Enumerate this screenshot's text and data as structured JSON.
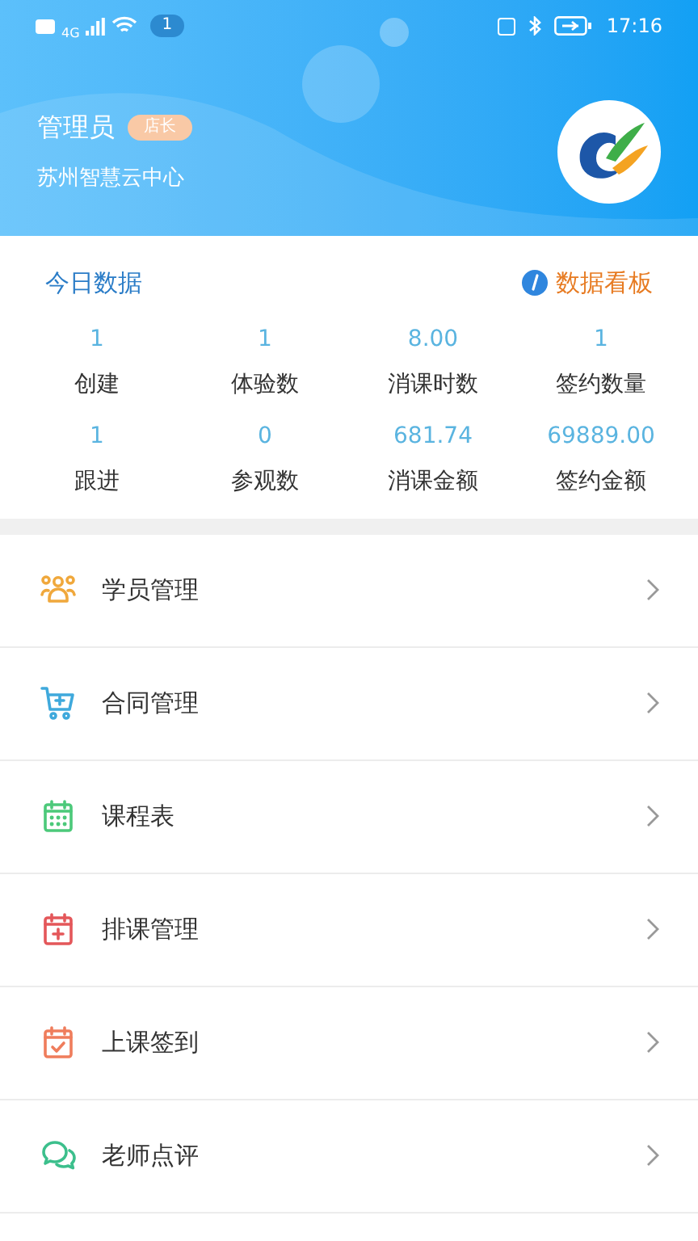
{
  "status_bar": {
    "network": "4G",
    "notification_count": "1",
    "time": "17:16"
  },
  "profile": {
    "name": "管理员",
    "role_badge": "店长",
    "organization": "苏州智慧云中心"
  },
  "today_data": {
    "title": "今日数据",
    "dashboard_link": "数据看板",
    "stats": [
      {
        "value": "1",
        "label": "创建"
      },
      {
        "value": "1",
        "label": "体验数"
      },
      {
        "value": "8.00",
        "label": "消课时数"
      },
      {
        "value": "1",
        "label": "签约数量"
      },
      {
        "value": "1",
        "label": "跟进"
      },
      {
        "value": "0",
        "label": "参观数"
      },
      {
        "value": "681.74",
        "label": "消课金额"
      },
      {
        "value": "69889.00",
        "label": "签约金额"
      }
    ]
  },
  "menu": [
    {
      "kind": "students",
      "label": "学员管理"
    },
    {
      "kind": "contracts",
      "label": "合同管理"
    },
    {
      "kind": "timetable",
      "label": "课程表"
    },
    {
      "kind": "scheduling",
      "label": "排课管理"
    },
    {
      "kind": "checkin",
      "label": "上课签到"
    },
    {
      "kind": "review",
      "label": "老师点评"
    }
  ]
}
